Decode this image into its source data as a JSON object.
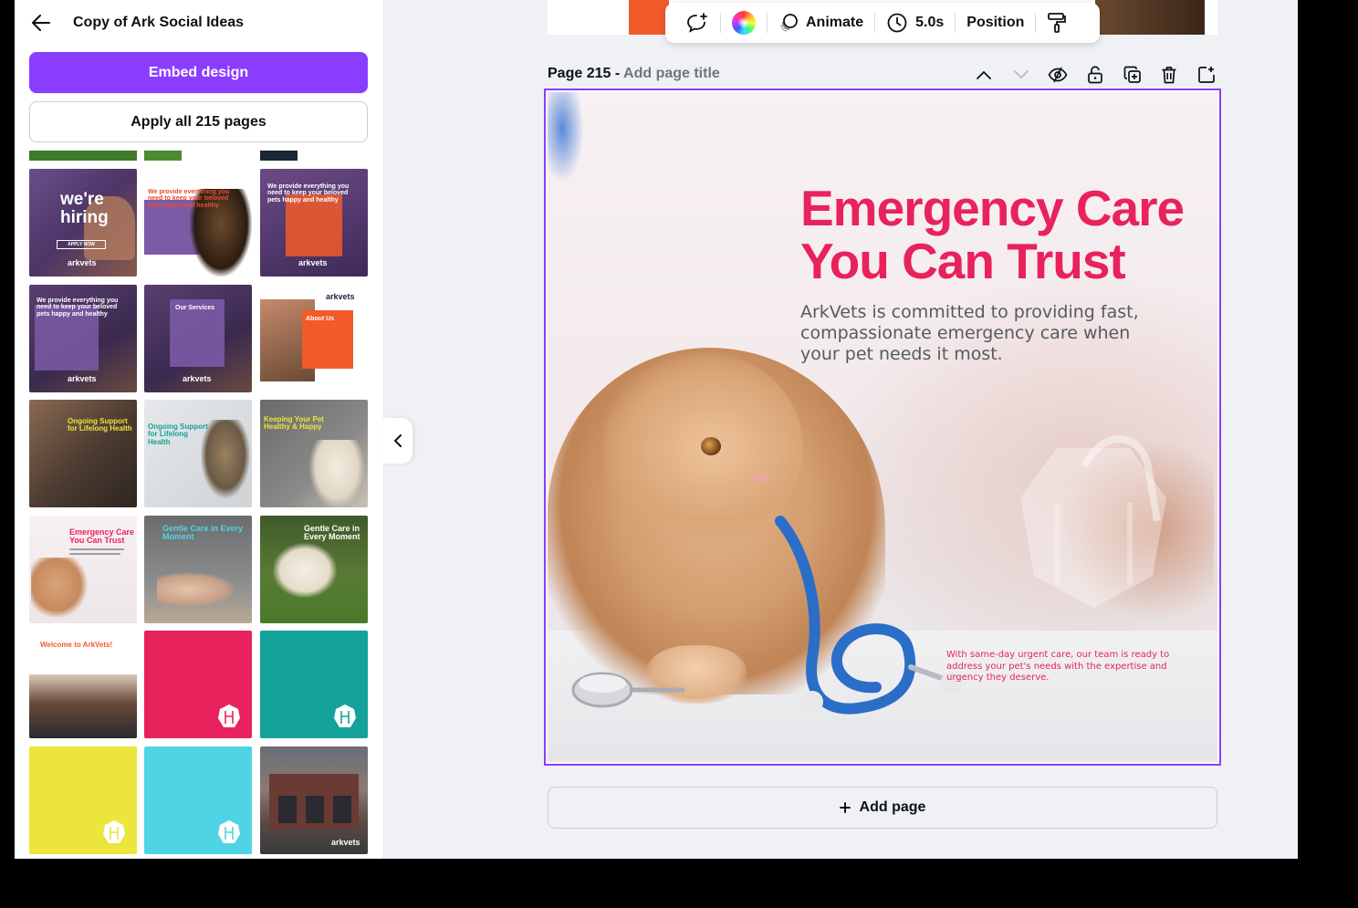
{
  "panel": {
    "title": "Copy of Ark Social Ideas",
    "embed_label": "Embed design",
    "apply_label": "Apply all 215 pages"
  },
  "thumbs": {
    "hiring": {
      "title": "we're hiring",
      "cta": "APPLY NOW",
      "brand": "arkvets"
    },
    "provide1": {
      "title": "We provide everything you need to keep your beloved pets happy and healthy"
    },
    "provide2": {
      "title": "We provide everything you need to keep your beloved pets happy and healthy",
      "brand": "arkvets"
    },
    "provide3": {
      "title": "We provide everything you need to keep your beloved pets happy and healthy",
      "brand": "arkvets"
    },
    "services": {
      "title": "Our Services",
      "brand": "arkvets"
    },
    "about": {
      "title": "About Us",
      "brand": "arkvets"
    },
    "support1": {
      "title": "Ongoing Support for Lifelong Health"
    },
    "support2": {
      "title": "Ongoing Support for Lifelong Health"
    },
    "keeping": {
      "title": "Keeping Your Pet Healthy & Happy"
    },
    "emergency": {
      "title": "Emergency Care You Can Trust"
    },
    "gentle1": {
      "title": "Gentle Care in Every Moment"
    },
    "gentle2": {
      "title": "Gentle Care in Every Moment"
    },
    "welcome": {
      "title": "Welcome to ArkVets!"
    },
    "building": {
      "brand": "arkvets"
    }
  },
  "toolbar": {
    "animate_label": "Animate",
    "duration_label": "5.0s",
    "position_label": "Position"
  },
  "page": {
    "label": "Page 215 -",
    "title_placeholder": "Add page title"
  },
  "design": {
    "headline": "Emergency Care\nYou Can Trust",
    "body": "ArkVets is committed to providing fast, compassionate emergency care when your pet needs it most.",
    "small": "With same-day urgent care, our team is ready to address your pet's needs with the expertise and urgency they deserve."
  },
  "add_page_label": "Add page",
  "colors": {
    "accent": "#8b3dff",
    "brand_pink": "#e8225c",
    "brand_orange": "#f25a2a",
    "brand_purple": "#7b5aa6",
    "teal": "#13a39a",
    "yellow": "#ece53b",
    "cyan": "#4fd4e6"
  }
}
